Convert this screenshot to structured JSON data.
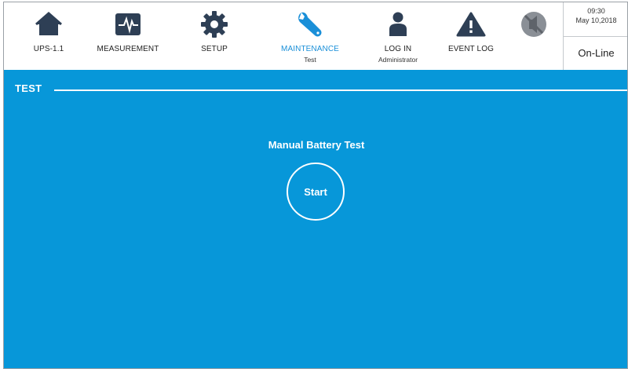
{
  "nav": {
    "ups": {
      "label": "UPS-1.1",
      "icon": "home-icon"
    },
    "measurement": {
      "label": "MEASUREMENT",
      "icon": "waveform-icon"
    },
    "setup": {
      "label": "SETUP",
      "icon": "gear-icon"
    },
    "maintenance": {
      "label": "MAINTENANCE",
      "sub": "Test",
      "icon": "wrench-icon",
      "active": true
    },
    "login": {
      "label": "LOG IN",
      "sub": "Administrator",
      "icon": "user-icon"
    },
    "event_log": {
      "label": "EVENT LOG",
      "icon": "warning-icon"
    },
    "mute": {
      "icon": "buzzer-muted-icon"
    }
  },
  "status": {
    "time": "09:30",
    "date": "May 10,2018",
    "mode": "On-Line"
  },
  "section": {
    "title": "TEST"
  },
  "test": {
    "title": "Manual Battery Test",
    "start_label": "Start"
  },
  "colors": {
    "content_bg": "#0797d9",
    "active_nav": "#1a8fd8",
    "icon_dark": "#2e3f55"
  }
}
